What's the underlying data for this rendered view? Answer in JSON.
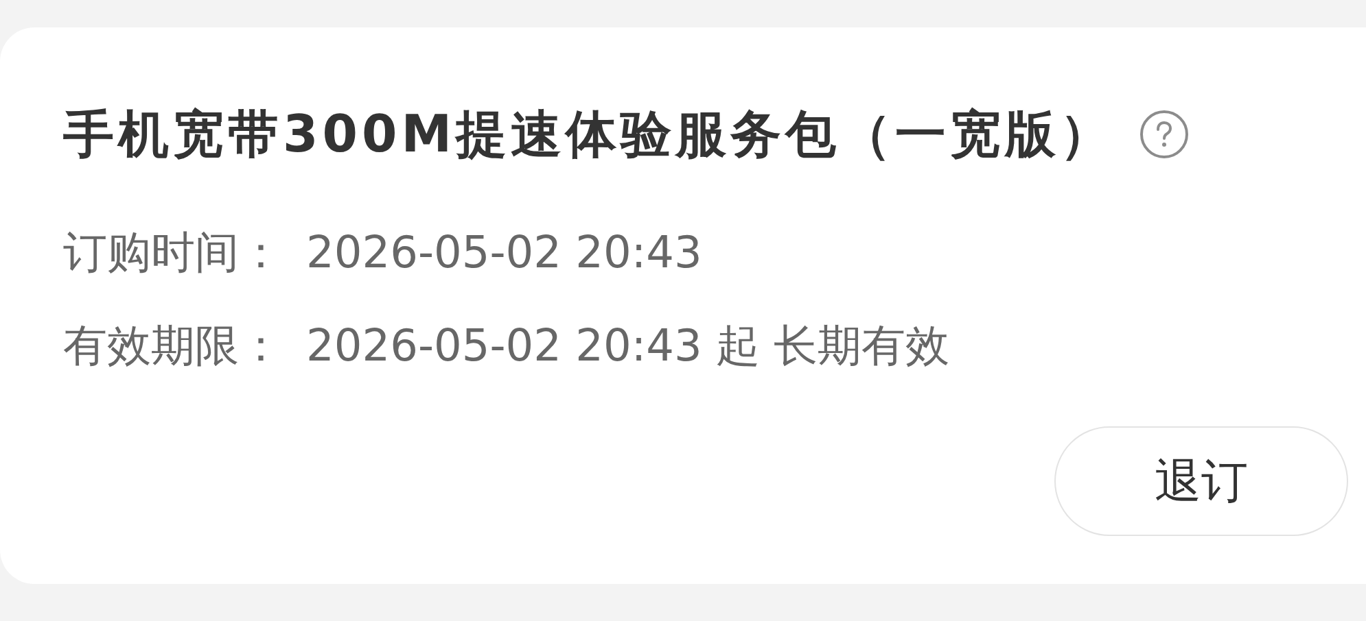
{
  "title": "手机宽带300M提速体验服务包（一宽版）",
  "details": [
    {
      "label": "订购时间：",
      "value": "2026-05-02 20:43"
    },
    {
      "label": "有效期限：",
      "value": "2026-05-02 20:43 起 长期有效"
    }
  ],
  "action_button": {
    "label": "退订"
  }
}
